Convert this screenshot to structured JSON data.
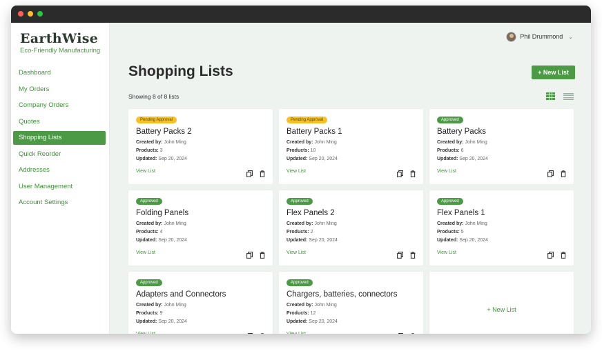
{
  "app": {
    "logo": "EarthWise",
    "tagline": "Eco-Friendly Manufacturing"
  },
  "sidebar": {
    "items": [
      {
        "label": "Dashboard",
        "active": false
      },
      {
        "label": "My Orders",
        "active": false
      },
      {
        "label": "Company Orders",
        "active": false
      },
      {
        "label": "Quotes",
        "active": false
      },
      {
        "label": "Shopping Lists",
        "active": true
      },
      {
        "label": "Quick Reorder",
        "active": false
      },
      {
        "label": "Addresses",
        "active": false
      },
      {
        "label": "User Management",
        "active": false
      },
      {
        "label": "Account Settings",
        "active": false
      }
    ]
  },
  "header": {
    "user_name": "Phil Drummond",
    "chevron": "⌄"
  },
  "main": {
    "title": "Shopping Lists",
    "new_list_label": "+ New List",
    "count_text": "Showing 8 of 8 lists",
    "labels": {
      "created_by": "Created by:",
      "products": "Products:",
      "updated": "Updated:",
      "view_list": "View List"
    },
    "lists": [
      {
        "status": "Pending Approval",
        "status_type": "pending",
        "name": "Battery Packs 2",
        "created_by": "John Ming",
        "products": "3",
        "updated": "Sep 20, 2024"
      },
      {
        "status": "Pending Approval",
        "status_type": "pending",
        "name": "Battery Packs 1",
        "created_by": "John Ming",
        "products": "10",
        "updated": "Sep 20, 2024"
      },
      {
        "status": "Approved",
        "status_type": "approved",
        "name": "Battery Packs",
        "created_by": "John Ming",
        "products": "6",
        "updated": "Sep 20, 2024"
      },
      {
        "status": "Approved",
        "status_type": "approved",
        "name": "Folding Panels",
        "created_by": "John Ming",
        "products": "4",
        "updated": "Sep 20, 2024"
      },
      {
        "status": "Approved",
        "status_type": "approved",
        "name": "Flex Panels 2",
        "created_by": "John Ming",
        "products": "2",
        "updated": "Sep 20, 2024"
      },
      {
        "status": "Approved",
        "status_type": "approved",
        "name": "Flex Panels 1",
        "created_by": "John Ming",
        "products": "5",
        "updated": "Sep 20, 2024"
      },
      {
        "status": "Approved",
        "status_type": "approved",
        "name": "Adapters and Connectors",
        "created_by": "John Ming",
        "products": "9",
        "updated": "Sep 20, 2024"
      },
      {
        "status": "Approved",
        "status_type": "approved",
        "name": "Chargers, batteries, connectors",
        "created_by": "John Ming",
        "products": "12",
        "updated": "Sep 20, 2024"
      }
    ],
    "new_card_label": "+ New List"
  },
  "icons": {
    "copy": "copy-icon",
    "delete": "trash-icon",
    "grid": "grid-view-icon",
    "list": "list-view-icon"
  },
  "colors": {
    "accent": "#4c9a45",
    "pending": "#f5c125",
    "background": "#eef3f0"
  }
}
